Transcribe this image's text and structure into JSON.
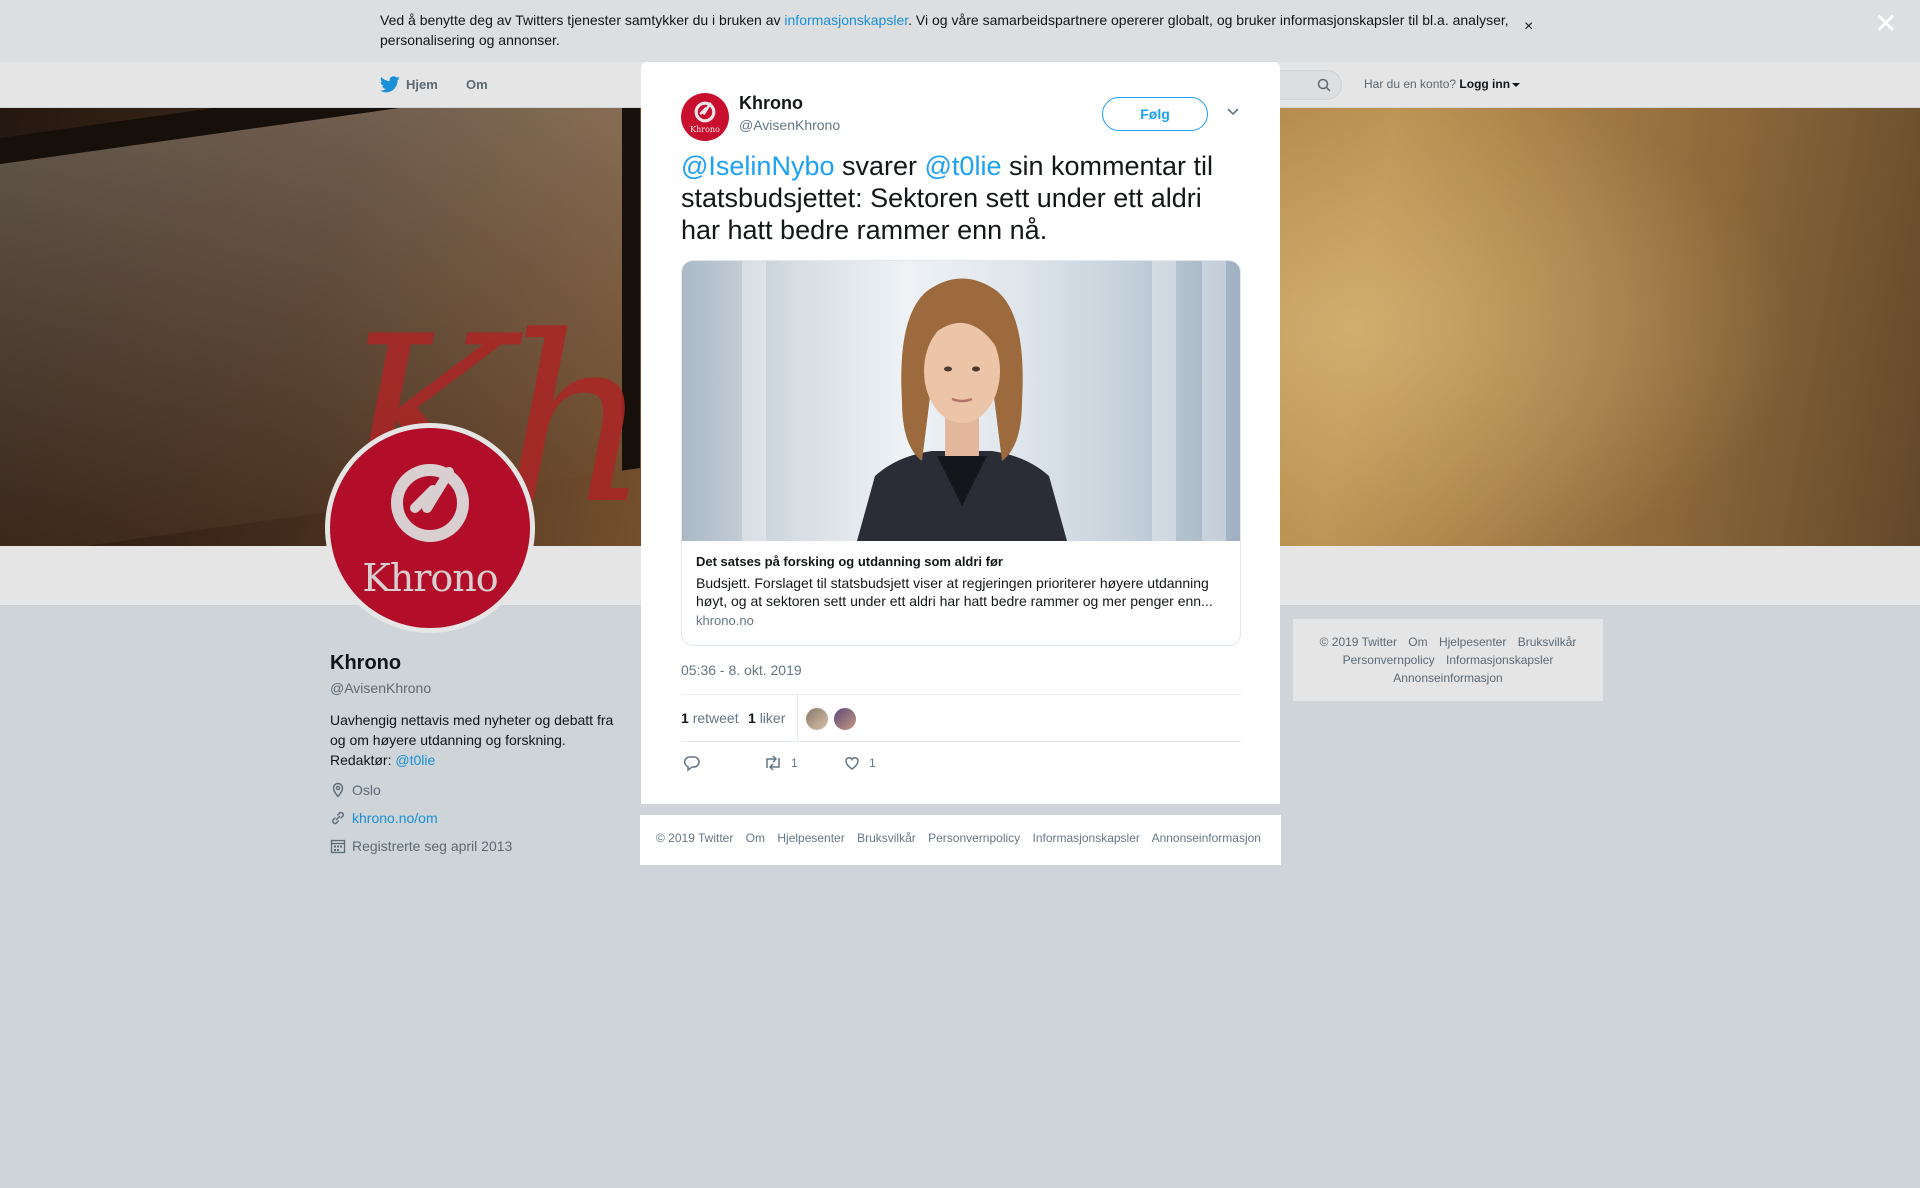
{
  "cookie": {
    "text_before": "Ved å benytte deg av Twitters tjenester samtykker du i bruken av ",
    "link": "informasjonskapsler",
    "text_after": ". Vi og våre samarbeidspartnere opererer globalt, og bruker informasjonskapsler til bl.a. analyser, personalisering og annonser.",
    "close": "×"
  },
  "nav": {
    "home": "Hjem",
    "about": "Om",
    "account_prompt": "Har du en konto?",
    "login": "Logg inn"
  },
  "profile": {
    "name": "Khrono",
    "handle": "@AvisenKhrono",
    "brand": "Khrono",
    "bio": "Uavhengig nettavis med nyheter og debatt fra og om høyere utdanning og forskning. Redaktør: ",
    "bio_mention": "@t0lie",
    "location": "Oslo",
    "website": "khrono.no/om",
    "joined": "Registrerte seg april 2013"
  },
  "side_footer": {
    "links": [
      "© 2019 Twitter",
      "Om",
      "Hjelpesenter",
      "Bruksvilkår",
      "Personvernpolicy",
      "Informasjonskapsler",
      "Annonseinformasjon"
    ]
  },
  "overlay": {
    "close": "✕"
  },
  "tweet": {
    "author_name": "Khrono",
    "author_handle": "@AvisenKhrono",
    "avatar_brand": "Khrono",
    "follow_label": "Følg",
    "mention1": "@IselinNybo",
    "text_mid": " svarer ",
    "mention2": "@t0lie",
    "text_end": " sin kommentar til statsbudsjettet: Sektoren sett under ett aldri har hatt bedre rammer enn nå.",
    "card": {
      "title": "Det satses på forsking og utdanning som aldri før",
      "description": "Budsjett. Forslaget til statsbudsjett viser at regjeringen prioriterer høyere utdanning høyt, og at sektoren sett under ett aldri har hatt bedre rammer og mer penger enn...",
      "domain": "khrono.no"
    },
    "timestamp": "05:36 - 8. okt. 2019",
    "retweets_count": "1",
    "retweets_label": "retweet",
    "likes_count": "1",
    "likes_label": "liker",
    "retweet_action_count": "1",
    "like_action_count": "1"
  },
  "modal_footer": {
    "links": [
      "© 2019 Twitter",
      "Om",
      "Hjelpesenter",
      "Bruksvilkår",
      "Personvernpolicy",
      "Informasjonskapsler",
      "Annonseinformasjon"
    ]
  },
  "colors": {
    "accent": "#1da1f2",
    "brand_red": "#c8102e",
    "background": "#e6ecf0"
  },
  "icons": [
    "twitter-bird-icon",
    "search-icon",
    "chevron-down-icon",
    "location-icon",
    "link-icon",
    "calendar-icon",
    "reply-icon",
    "retweet-icon",
    "heart-icon",
    "close-icon"
  ]
}
